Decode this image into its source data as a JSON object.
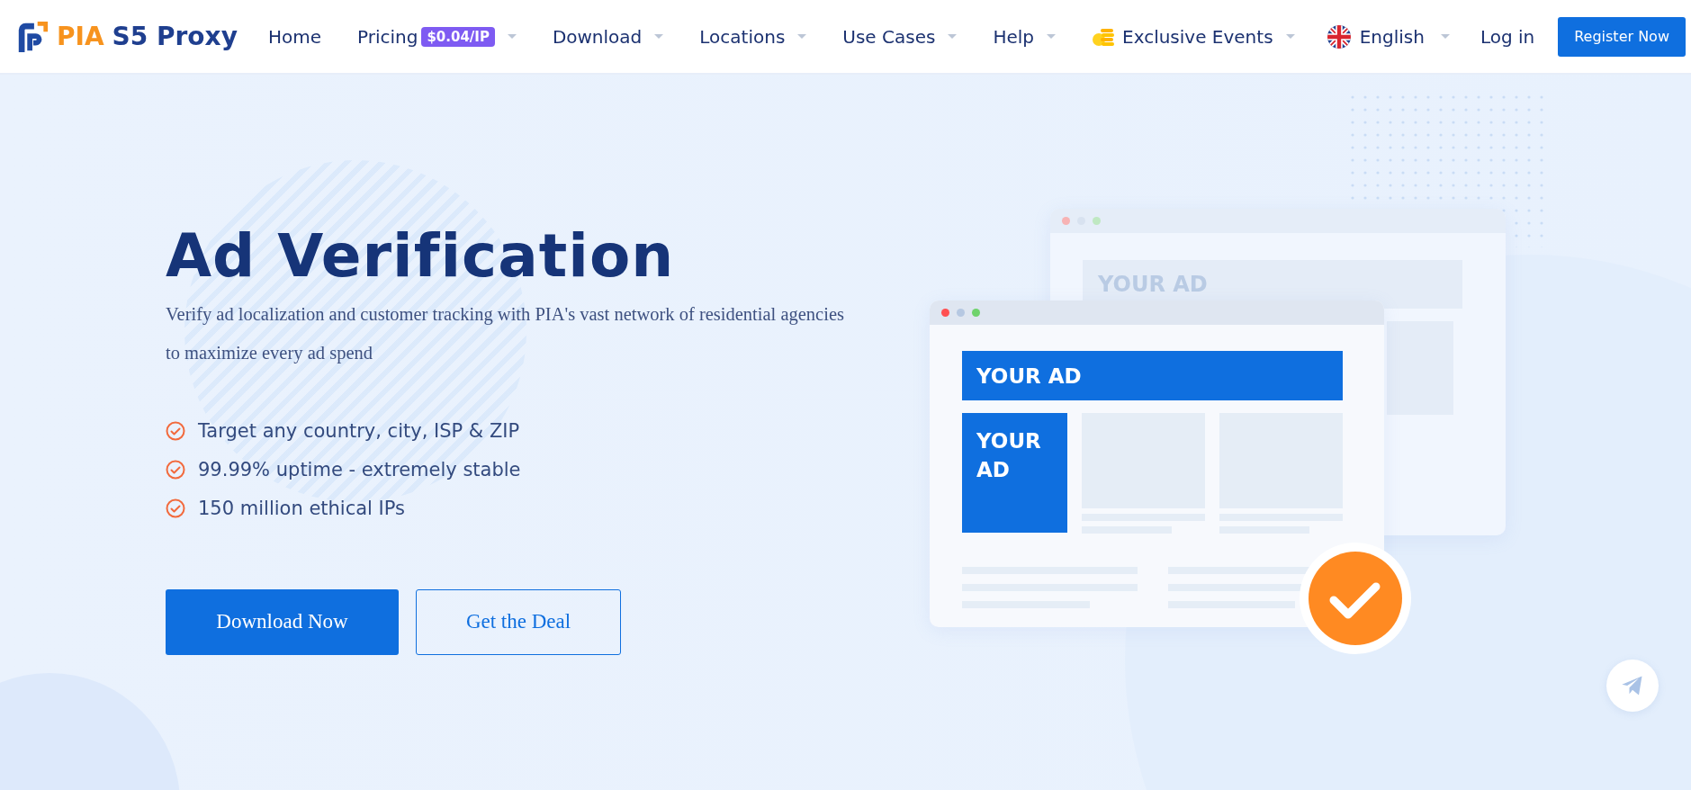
{
  "header": {
    "logo": {
      "brand": "PIA",
      "product": "S5 Proxy"
    },
    "nav": [
      {
        "label": "Home",
        "dropdown": false
      },
      {
        "label": "Pricing",
        "badge": "$0.04/IP",
        "dropdown": true
      },
      {
        "label": "Download",
        "dropdown": true
      },
      {
        "label": "Locations",
        "dropdown": true
      },
      {
        "label": "Use Cases",
        "dropdown": true
      },
      {
        "label": "Help",
        "dropdown": true
      },
      {
        "label": "Exclusive Events",
        "dropdown": true,
        "kind": "event"
      }
    ],
    "language": {
      "label": "English",
      "dropdown": true
    },
    "login": "Log in",
    "register": "Register Now"
  },
  "hero": {
    "title": "Ad Verification",
    "description": "Verify ad localization and customer tracking with PIA's vast network of residential agencies to maximize every ad spend",
    "features": [
      "Target any country, city, ISP & ZIP",
      "99.99% uptime - extremely stable",
      "150 million ethical IPs"
    ],
    "buttons": [
      {
        "label": "Download Now",
        "kind": "primary"
      },
      {
        "label": "Get the Deal",
        "kind": "outline"
      }
    ]
  },
  "illustration": {
    "back_window": {
      "ad_label": "YOUR AD"
    },
    "front_window": {
      "banner_ad": "YOUR AD",
      "side_ad": "YOUR AD"
    },
    "verified": true
  }
}
